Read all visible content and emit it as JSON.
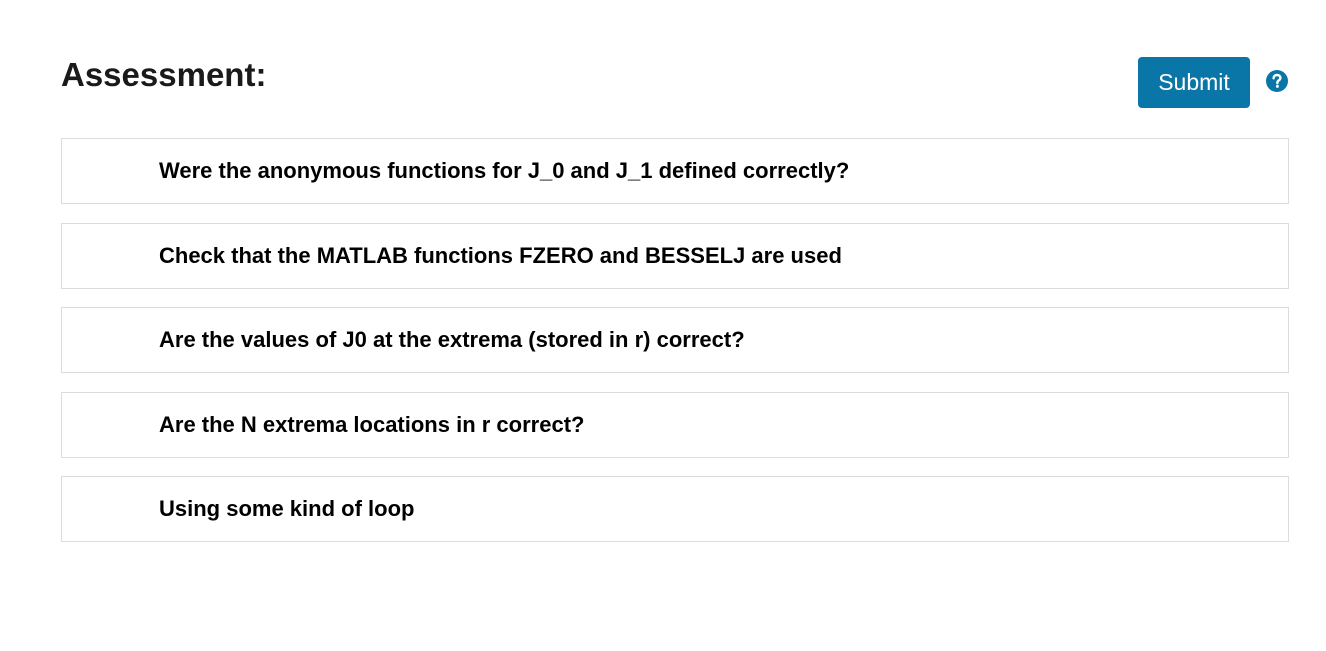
{
  "header": {
    "title": "Assessment:",
    "submit_label": "Submit",
    "help_icon": "question-circle-icon"
  },
  "criteria": [
    {
      "label": "Were the anonymous functions for J_0 and J_1 defined correctly?"
    },
    {
      "label": "Check that the MATLAB functions FZERO and BESSELJ are used"
    },
    {
      "label": "Are the values of J0 at the extrema (stored in r) correct?"
    },
    {
      "label": "Are the N extrema locations in r correct?"
    },
    {
      "label": "Using some kind of loop"
    }
  ],
  "colors": {
    "accent": "#0a76a8",
    "border": "#dcdcdc",
    "text": "#1a1a1a"
  }
}
